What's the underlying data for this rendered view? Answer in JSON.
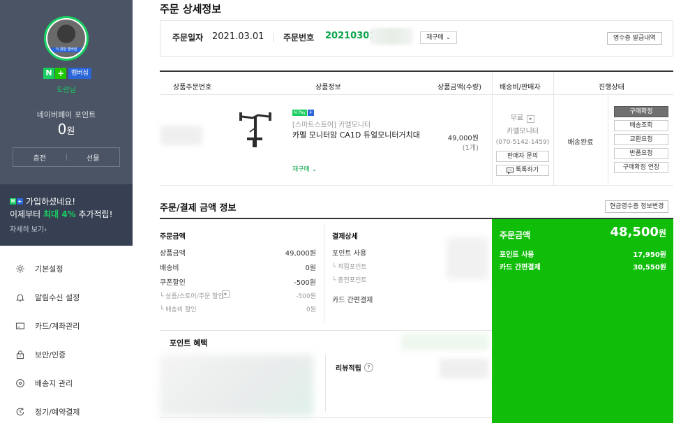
{
  "sidebar": {
    "avatar_tag": "이 경험 멤버쉽",
    "membership_n": "N",
    "membership_plus": "+",
    "membership_label": "멤버십",
    "user_name": "도련님",
    "points_label": "네이버페이 포인트",
    "points_value": "0",
    "points_unit": "원",
    "charge_label": "충전",
    "gift_label": "선물",
    "promo": {
      "badge_n": "N",
      "badge_plus": "+",
      "line1": "가입하셨네요!",
      "line2_prefix": "이제부터 ",
      "line2_highlight": "최대 4%",
      "line2_suffix": " 추가적립!",
      "more": "자세히 보기›"
    },
    "menu": [
      {
        "label": "기본설정",
        "icon": "gear-icon"
      },
      {
        "label": "알림수신 설정",
        "icon": "bell-icon"
      },
      {
        "label": "카드/계좌관리",
        "icon": "card-icon"
      },
      {
        "label": "보안/인증",
        "icon": "lock-icon"
      },
      {
        "label": "배송지 관리",
        "icon": "location-icon"
      },
      {
        "label": "정기/예약결제",
        "icon": "recurring-icon"
      }
    ]
  },
  "order": {
    "page_title": "주문 상세정보",
    "date_label": "주문일자",
    "date_value": "2021.03.01",
    "number_label": "주문번호",
    "number_value": "20210301",
    "reorder_button": "재구매 ⌄",
    "receipt_button": "영수증 발급내역"
  },
  "table": {
    "headers": [
      "상품주문번호",
      "상품정보",
      "상품금액(수량)",
      "배송비/판매자",
      "진행상태"
    ],
    "item": {
      "npay_badge": "N Pay",
      "npay_plus": "+",
      "store": "[스마트스토어] 카멜모니터",
      "name": "카멜 모니터암 CA1D 듀얼모니터거치대",
      "reorder_link": "재구매 ⌄",
      "price": "49,000원",
      "qty": "(1개)",
      "shipping": "무료",
      "shipping_arrow": "▸",
      "seller": "카멜모니터",
      "phone": "(070-5142-1459)",
      "inquiry_button": "판매자 문의",
      "talk_button": "톡톡하기",
      "status": "배송완료",
      "status_buttons": [
        "구매확정",
        "배송조회",
        "교환요청",
        "반품요청",
        "구매확정 연장"
      ]
    }
  },
  "payment": {
    "title": "주문/결제 금액 정보",
    "cash_receipt_button": "현금영수증 정보변경",
    "amount_header": "주문금액",
    "detail_header": "결제상세",
    "rows": [
      {
        "label": "상품금액",
        "value": "49,000원"
      },
      {
        "label": "배송비",
        "value": "0원"
      },
      {
        "label": "쿠폰할인",
        "value": "-500원"
      }
    ],
    "sub_rows": [
      {
        "label": "└ 상품/스토어/주문 할인",
        "value": "-500원"
      },
      {
        "label": "└ 배송비 할인",
        "value": "0원"
      }
    ],
    "detail_rows": [
      "포인트 사용",
      "└ 적립포인트",
      "└ 충전포인트",
      "카드 간편결제"
    ],
    "summary_label": "주문금액",
    "summary_value": "48,500",
    "summary_unit": "원",
    "summary_rows": [
      {
        "label": "포인트 사용",
        "value": "17,950원"
      },
      {
        "label": "카드 간편결제",
        "value": "30,550원"
      }
    ],
    "benefit_title": "포인트 혜택",
    "review_label": "리뷰적립",
    "review_help": "?"
  },
  "colors": {
    "naver_green": "#19ce60",
    "summary_green": "#10be0a",
    "sidebar_dark": "#4a5464",
    "promo_dark": "#364052"
  }
}
